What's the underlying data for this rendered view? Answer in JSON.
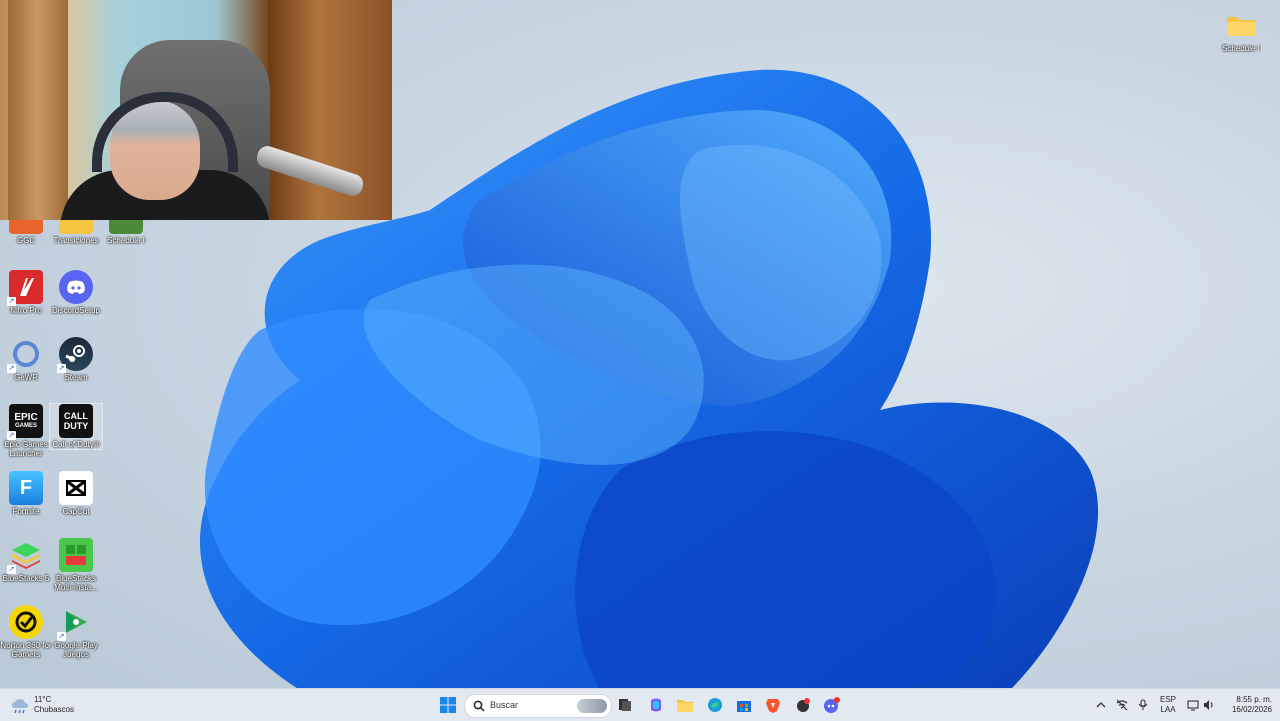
{
  "desktop": {
    "top_right_folder": {
      "label": "Schedule I",
      "icon": "folder-icon"
    },
    "icons_row_cut": [
      {
        "label": "GGC",
        "icon": "ggc-icon"
      },
      {
        "label": "Transiciones",
        "icon": "folder-icon"
      },
      {
        "label": "Schedule I",
        "icon": "game-icon"
      }
    ],
    "icons": [
      {
        "label": "Nitro Pro",
        "icon": "nitro-pro-icon"
      },
      {
        "label": "DiscordSetup",
        "icon": "discord-icon"
      },
      {
        "label": "GeWR",
        "icon": "gewr-icon"
      },
      {
        "label": "Steam",
        "icon": "steam-icon"
      },
      {
        "label": "Epic Games Launcher",
        "icon": "epic-games-icon",
        "glyph": "EPIC\nGAMES"
      },
      {
        "label": "Call of Duty®",
        "icon": "call-of-duty-icon",
        "glyph": "CALL\nDUTY"
      },
      {
        "label": "Fortnite",
        "icon": "fortnite-icon",
        "glyph": "F"
      },
      {
        "label": "CapCut",
        "icon": "capcut-icon"
      },
      {
        "label": "BlueStacks 5",
        "icon": "bluestacks-icon"
      },
      {
        "label": "BlueStacks Multi-Insta...",
        "icon": "bluestacks-multi-icon"
      },
      {
        "label": "Norton 360 for Gamers",
        "icon": "norton-icon"
      },
      {
        "label": "Google Play Juegos",
        "icon": "google-play-games-icon"
      }
    ]
  },
  "taskbar": {
    "weather": {
      "temp": "11°C",
      "condition": "Chubascos",
      "icon": "weather-icon"
    },
    "search": {
      "placeholder": "Buscar",
      "icon": "search-icon"
    },
    "pinned": [
      {
        "name": "start",
        "icon": "windows-start-icon"
      },
      {
        "name": "task-view",
        "icon": "task-view-icon"
      },
      {
        "name": "copilot",
        "icon": "copilot-icon"
      },
      {
        "name": "file-explorer",
        "icon": "folder-icon"
      },
      {
        "name": "edge",
        "icon": "edge-icon"
      },
      {
        "name": "store",
        "icon": "store-icon"
      },
      {
        "name": "brave",
        "icon": "brave-icon"
      },
      {
        "name": "app",
        "icon": "app-icon"
      },
      {
        "name": "discord",
        "icon": "discord-icon"
      }
    ],
    "tray": {
      "language_top": "ESP",
      "language_bottom": "LAA",
      "time": "8:55 p. m.",
      "date": "16/02/2026"
    }
  },
  "colors": {
    "accent": "#1a6fe0",
    "discord": "#5865f2",
    "taskbar": "#e4eaf0"
  }
}
